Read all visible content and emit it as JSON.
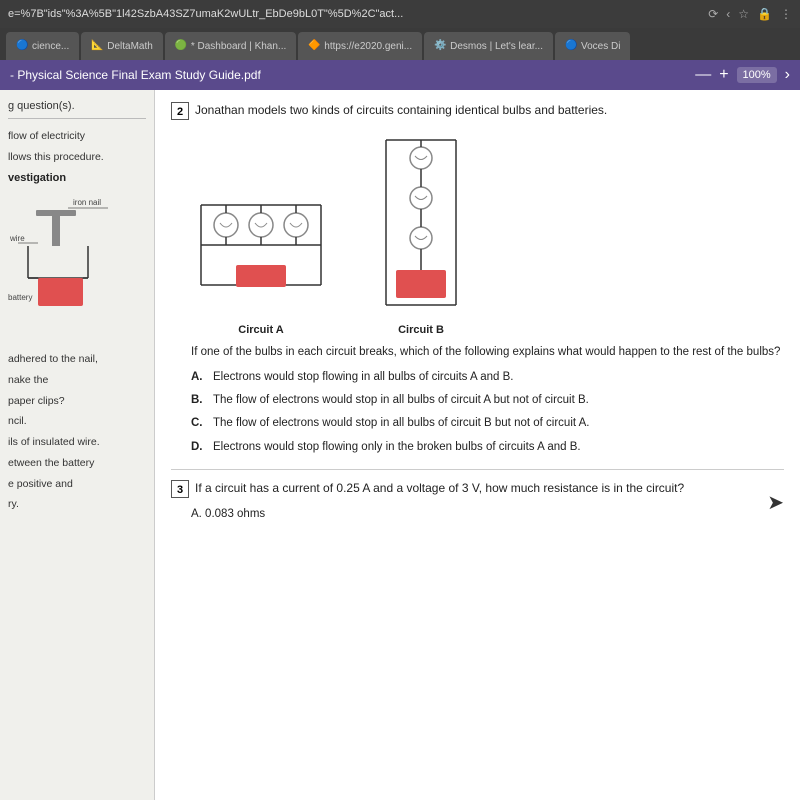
{
  "browser": {
    "url": "e=%7B\"ids\"%3A%5B\"1l42SzbA43SZ7umaK2wULtr_EbDe9bL0T\"%5D%2C\"act...",
    "tabs": [
      {
        "label": "cience...",
        "icon": "🔵"
      },
      {
        "label": "DeltaMath",
        "icon": "📐"
      },
      {
        "label": "* Dashboard | Khan...",
        "icon": "🟢"
      },
      {
        "label": "https://e2020.geni...",
        "icon": "🔶"
      },
      {
        "label": "Desmos | Let's lear...",
        "icon": "⚙️"
      },
      {
        "label": "Voces Di",
        "icon": "🔵"
      }
    ],
    "icons": [
      "⬆",
      "⬇",
      "★",
      "🔒",
      "⋮"
    ]
  },
  "pdf_toolbar": {
    "title": "- Physical Science Final Exam Study Guide.pdf",
    "minus_label": "—",
    "plus_label": "+",
    "zoom": "100%",
    "nav_arrow": "›"
  },
  "sidebar": {
    "question_hint": "g question(s).",
    "text1": "flow of electricity",
    "text2": "llows this procedure.",
    "heading": "vestigation",
    "label_iron_nail": "iron nail",
    "label_wire": "wire",
    "label_battery": "battery",
    "bottom_text1": "adhered to the nail,",
    "bottom_text2": "nake the",
    "bottom_text3": "paper clips?",
    "bottom_text4": "ncil.",
    "bottom_text5": "ils of insulated wire.",
    "bottom_text6": "etween the battery",
    "bottom_text7": "e positive and",
    "bottom_text8": "ry."
  },
  "question2": {
    "number": "2",
    "text": "Jonathan models two kinds of circuits containing identical bulbs and batteries.",
    "circuit_a_label": "Circuit A",
    "circuit_b_label": "Circuit B",
    "if_text": "If one of the bulbs in each circuit breaks, which of the following explains what would happen to the rest of the bulbs?",
    "choices": [
      {
        "letter": "A.",
        "text": "Electrons would stop flowing in all bulbs of circuits A and B."
      },
      {
        "letter": "B.",
        "text": "The flow of electrons would stop in all bulbs of circuit A but not of circuit B."
      },
      {
        "letter": "C.",
        "text": "The flow of electrons would stop in all bulbs of circuit B but not of circuit A."
      },
      {
        "letter": "D.",
        "text": "Electrons would stop flowing only in the broken bulbs of circuits A and B."
      }
    ]
  },
  "question3": {
    "number": "3",
    "text": "If a circuit has a current of 0.25 A and a voltage of 3 V, how much resistance is in the circuit?",
    "choice_a": "A.   0.083 ohms"
  },
  "colors": {
    "pdf_toolbar_bg": "#5a4a8c",
    "circuit_battery_fill": "#e05050",
    "circuit_wire": "#333333",
    "circuit_bulb": "#888888"
  }
}
